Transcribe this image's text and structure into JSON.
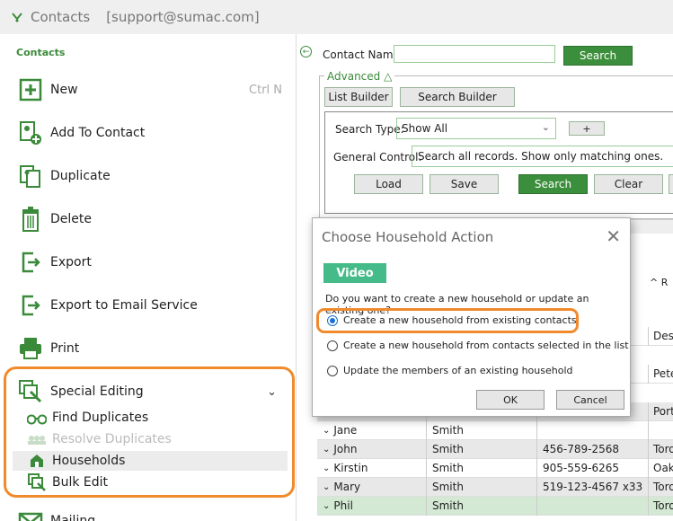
{
  "window": {
    "title": "Contacts",
    "account": "[support@sumac.com]"
  },
  "sidebar": {
    "section_title": "Contacts",
    "items": [
      {
        "label": "New",
        "shortcut": "Ctrl N",
        "icon": "plus-square-icon"
      },
      {
        "label": "Add To Contact",
        "icon": "add-to-contact-icon"
      },
      {
        "label": "Duplicate",
        "icon": "duplicate-icon"
      },
      {
        "label": "Delete",
        "icon": "trash-icon"
      },
      {
        "label": "Export",
        "icon": "export-icon"
      },
      {
        "label": "Export to Email Service",
        "icon": "export-email-icon"
      },
      {
        "label": "Print",
        "icon": "printer-icon"
      },
      {
        "label": "Special Editing",
        "icon": "special-editing-icon"
      }
    ],
    "sub_items": [
      {
        "label": "Find Duplicates",
        "icon": "binoculars-icon"
      },
      {
        "label": "Resolve Duplicates",
        "icon": "resolve-duplicates-icon"
      },
      {
        "label": "Households",
        "icon": "house-icon"
      },
      {
        "label": "Bulk Edit",
        "icon": "bulk-edit-icon"
      }
    ],
    "next_section": "Mailing"
  },
  "search": {
    "contact_name_label": "Contact Name",
    "contact_name_value": "",
    "search_label": "Search",
    "advanced_label": "Advanced △",
    "list_builder_label": "List Builder",
    "search_builder_label": "Search Builder",
    "search_type_label": "Search Type:",
    "search_type_value": "Show All",
    "plus_label": "+",
    "general_control_label": "General Control:",
    "general_control_value": "Search all records. Show only matching ones.",
    "load_label": "Load",
    "save_label": "Save",
    "search2_label": "Search",
    "clear_label": "Clear"
  },
  "table": {
    "col4_header": "R",
    "rows": [
      {
        "first": "",
        "last": "",
        "phone": "",
        "city": "Des I"
      },
      {
        "first": "",
        "last": "",
        "phone": "",
        "city": "Pete"
      },
      {
        "first": "",
        "last": "",
        "phone": "",
        "city": "Port"
      },
      {
        "first": "Jane",
        "last": "Smith",
        "phone": "",
        "city": ""
      },
      {
        "first": "John",
        "last": "Smith",
        "phone": "456-789-2568",
        "city": "Toro"
      },
      {
        "first": "Kirstin",
        "last": "Smith",
        "phone": "905-559-6265",
        "city": "Oakv"
      },
      {
        "first": "Mary",
        "last": "Smith",
        "phone": "519-123-4567 x33",
        "city": "Toro"
      },
      {
        "first": "Phil",
        "last": "Smith",
        "phone": "",
        "city": "Toro"
      }
    ]
  },
  "dialog": {
    "title": "Choose Household Action",
    "video_label": "Video",
    "question": "Do you want to create a new household or update an existing one?",
    "options": [
      {
        "label": "Create a new household from existing contacts",
        "selected": true
      },
      {
        "label": "Create a new household from contacts selected in the list",
        "selected": false
      },
      {
        "label": "Update the members of an existing household",
        "selected": false
      }
    ],
    "ok_label": "OK",
    "cancel_label": "Cancel"
  },
  "colors": {
    "accent": "#3b8e3b",
    "highlight": "#f08a2c",
    "video": "#44bb88"
  }
}
